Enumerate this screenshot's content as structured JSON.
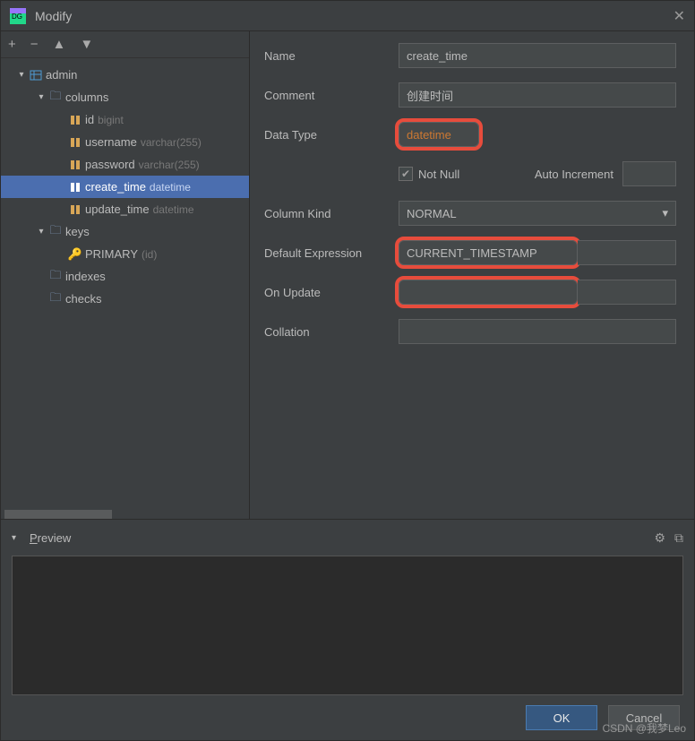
{
  "window": {
    "title": "Modify"
  },
  "toolbar": {
    "add": "+",
    "remove": "−",
    "up": "▲",
    "down": "▼"
  },
  "tree": {
    "root": {
      "label": "admin"
    },
    "columns": {
      "label": "columns",
      "items": [
        {
          "name": "id",
          "type": "bigint"
        },
        {
          "name": "username",
          "type": "varchar(255)"
        },
        {
          "name": "password",
          "type": "varchar(255)"
        },
        {
          "name": "create_time",
          "type": "datetime"
        },
        {
          "name": "update_time",
          "type": "datetime"
        }
      ]
    },
    "keys": {
      "label": "keys",
      "primary": {
        "name": "PRIMARY",
        "cols": "(id)"
      }
    },
    "indexes": {
      "label": "indexes"
    },
    "checks": {
      "label": "checks"
    }
  },
  "form": {
    "labels": {
      "name": "Name",
      "comment": "Comment",
      "dataType": "Data Type",
      "notNull": "Not Null",
      "autoInc": "Auto Increment",
      "columnKind": "Column Kind",
      "defaultExpr": "Default Expression",
      "onUpdate": "On Update",
      "collation": "Collation"
    },
    "values": {
      "name": "create_time",
      "comment": "创建时间",
      "dataType": "datetime",
      "notNull": true,
      "autoInc": "",
      "columnKind": "NORMAL",
      "defaultExpr": "CURRENT_TIMESTAMP",
      "onUpdate": "",
      "collation": ""
    }
  },
  "preview": {
    "label": "Preview"
  },
  "buttons": {
    "ok": "OK",
    "cancel": "Cancel"
  },
  "watermark": "CSDN @我梦Leo"
}
